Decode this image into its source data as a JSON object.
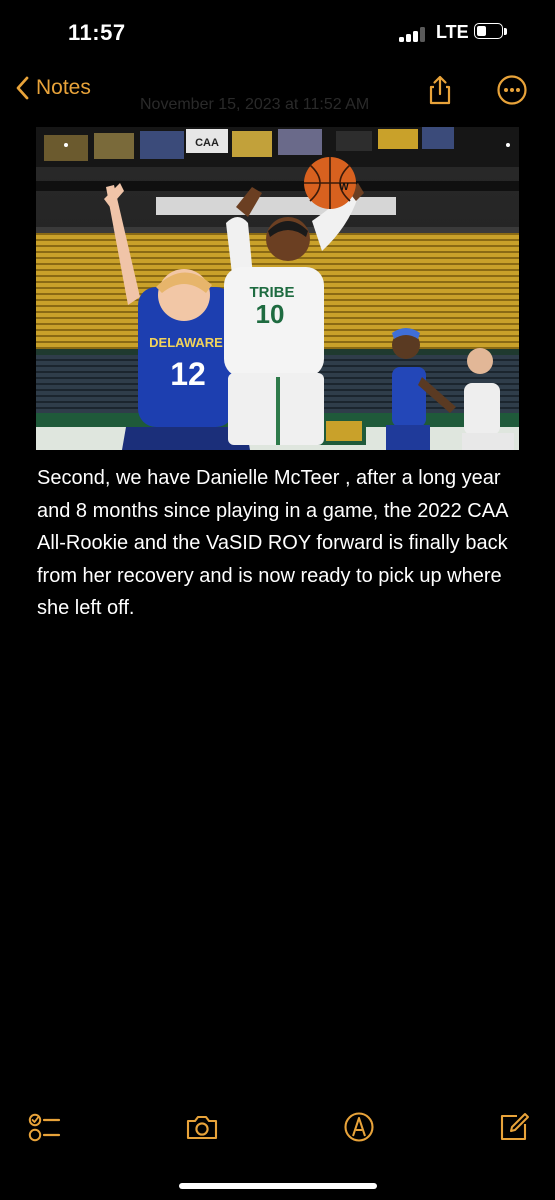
{
  "status_bar": {
    "time": "11:57",
    "carrier": "LTE",
    "signal_bars": 3,
    "battery_level": 0.3
  },
  "nav": {
    "back_label": "Notes",
    "date": "November 15, 2023 at 11:52 AM",
    "share_icon": "share-icon",
    "more_icon": "ellipsis-circle-icon"
  },
  "note": {
    "image_icon": "basketball-photo",
    "body": "Second, we have Danielle McTeer , after a long year and 8 months since playing in a game, the 2022 CAA All-Rookie  and the VaSID ROY forward is finally back from her recovery and is now ready to pick up where she left off."
  },
  "photo_text": {
    "caa": "CAA",
    "left_jersey_team": "DELAWARE",
    "left_jersey_number": "12",
    "right_jersey_team": "TRIBE",
    "right_jersey_number": "10",
    "ball_brand": "W"
  },
  "toolbar": {
    "checklist_icon": "checklist-icon",
    "camera_icon": "camera-icon",
    "markup_icon": "pen-circle-icon",
    "compose_icon": "compose-icon"
  },
  "colors": {
    "accent": "#e8a33a",
    "background": "#000000",
    "text": "#ffffff"
  }
}
